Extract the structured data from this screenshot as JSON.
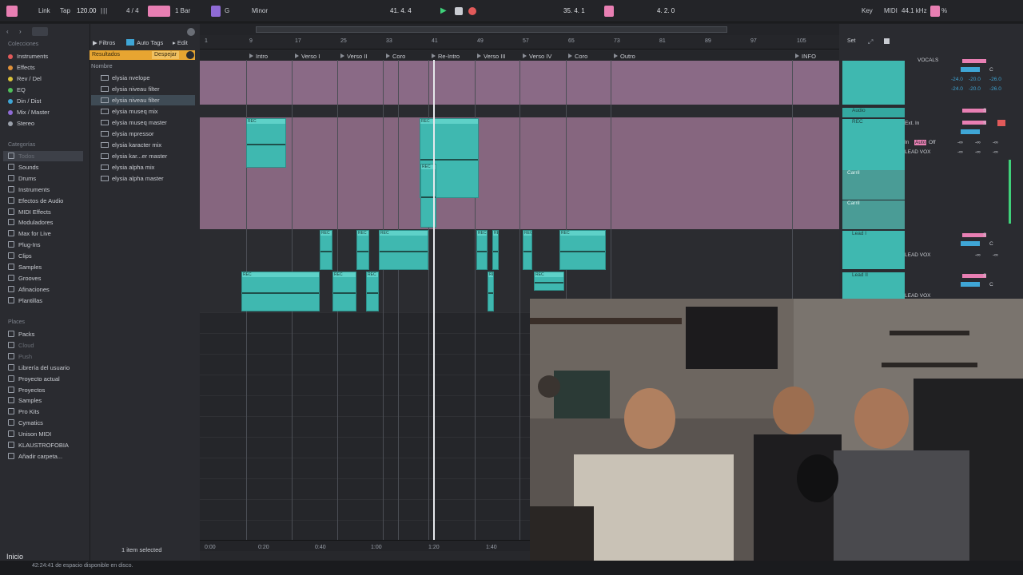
{
  "control_bar": {
    "link": "Link",
    "tap": "Tap",
    "tempo": "120.00",
    "time_signature": "4 / 4",
    "quantize": "1 Bar",
    "key": "G",
    "scale": "Minor",
    "position": "41.   4.   4",
    "loop_start": "35.   4.   1",
    "loop_length": "4.   2.   0",
    "key_btn": "Key",
    "midi_btn": "MIDI",
    "sample_rate": "44.1 kHz",
    "cpu": "%"
  },
  "browser": {
    "collections_title": "Colecciones",
    "collections": [
      {
        "label": "Instruments",
        "color": "#e25a5a"
      },
      {
        "label": "Effects",
        "color": "#e0913a"
      },
      {
        "label": "Rev / Del",
        "color": "#d9c23a"
      },
      {
        "label": "EQ",
        "color": "#4fbf5a"
      },
      {
        "label": "Din / Dist",
        "color": "#3fa6d6"
      },
      {
        "label": "Mix / Master",
        "color": "#8f6bd6"
      },
      {
        "label": "Stereo",
        "color": "#9aa0aa"
      }
    ],
    "categories_title": "Categorías",
    "categories": [
      "Todos",
      "Sounds",
      "Drums",
      "Instruments",
      "Efectos de Audio",
      "MIDI Effects",
      "Moduladores",
      "Max for Live",
      "Plug-Ins",
      "Clips",
      "Samples",
      "Grooves",
      "Afinaciones",
      "Plantillas"
    ],
    "places_title": "Places",
    "places": [
      "Packs",
      "Cloud",
      "Push",
      "Librería del usuario",
      "Proyecto actual",
      "Proyectos",
      "Samples",
      "Pro Kits",
      "Cymatics",
      "Unison MIDI",
      "KLAUSTROFOBIA",
      "Añadir carpeta..."
    ],
    "filters_btn": "Filtros",
    "auto_tags_btn": "Auto Tags",
    "edit_btn": "Edit",
    "results_label": "Resultados",
    "clear_btn": "Despejar",
    "name_header": "Nombre",
    "files": [
      "elysia nvelope",
      "elysia niveau filter",
      "elysia niveau filter",
      "elysia museq mix",
      "elysia museq master",
      "elysia mpressor",
      "elysia karacter mix",
      "elysia kar...er master",
      "elysia alpha mix",
      "elysia alpha master"
    ],
    "selection_status": "1 item selected"
  },
  "arrangement": {
    "bar_numbers": [
      "1",
      "9",
      "17",
      "25",
      "33",
      "41",
      "49",
      "57",
      "65",
      "73",
      "81",
      "89",
      "97",
      "105"
    ],
    "locators": [
      "Intro",
      "Verso I",
      "Verso II",
      "Coro",
      "Re-Intro",
      "Verso III",
      "Verso IV",
      "Coro",
      "Outro",
      "INFO"
    ],
    "time_labels": [
      "0:00",
      "0:20",
      "0:40",
      "1:00",
      "1:20",
      "1:40"
    ],
    "clip_label": "REC"
  },
  "mixer": {
    "set_label": "Set",
    "tracks": [
      {
        "name": "Audio"
      },
      {
        "name": "REC"
      },
      {
        "name": "Carril"
      },
      {
        "name": "Carril"
      },
      {
        "name": "Lead I"
      },
      {
        "name": "Lead II"
      }
    ],
    "input_type": "Ext. In",
    "monitor": [
      "In",
      "Auto",
      "Off"
    ],
    "routing": "LEAD VOX",
    "vocals_label": "VOCALS",
    "db_values": [
      "-24.0",
      "-20.0",
      "-26.0"
    ],
    "inf": "-∞",
    "pan": "C",
    "solo": "S"
  },
  "status": {
    "left_label": "Inicio",
    "disk_space": "42:24:41 de espacio disponible en disco."
  }
}
